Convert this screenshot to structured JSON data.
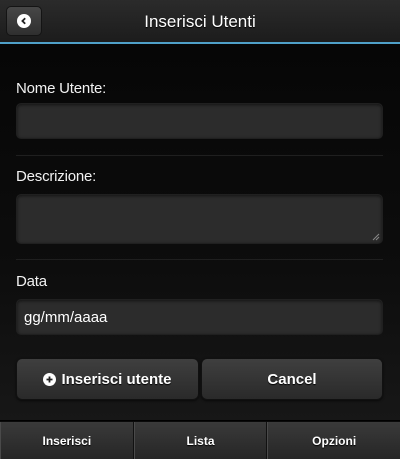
{
  "header": {
    "title": "Inserisci Utenti",
    "back_icon": "chevron-left-circle-icon"
  },
  "form": {
    "username_label": "Nome Utente:",
    "username_value": "",
    "description_label": "Descrizione:",
    "description_value": "",
    "date_label": "Data",
    "date_value": "gg/mm/aaaa"
  },
  "actions": {
    "insert_label": "Inserisci utente",
    "insert_icon": "plus-circle-icon",
    "cancel_label": "Cancel"
  },
  "navbar": {
    "items": [
      "Inserisci",
      "Lista",
      "Opzioni"
    ]
  },
  "colors": {
    "accent": "#4fa0c8",
    "background": "#000000",
    "field": "#2c2c2c"
  }
}
